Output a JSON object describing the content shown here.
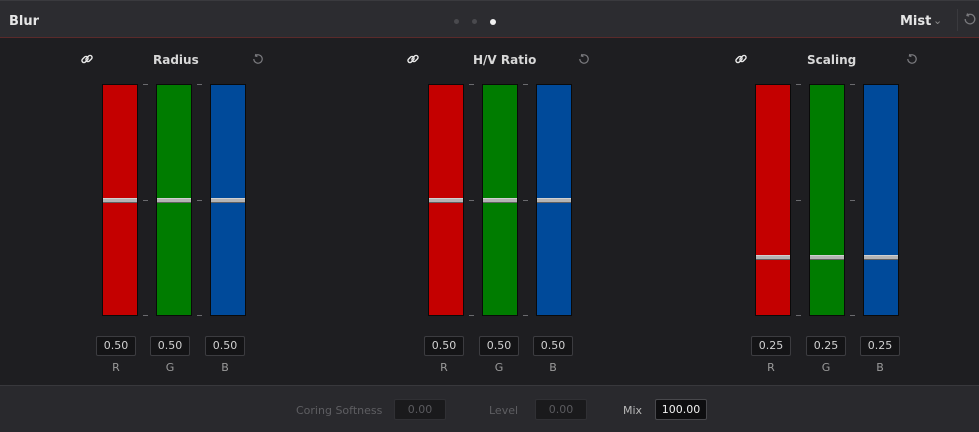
{
  "header": {
    "title": "Blur",
    "page_dots": 3,
    "active_dot": 3,
    "mode": "Mist"
  },
  "panels": [
    {
      "title": "Radius",
      "channels": [
        {
          "label": "R",
          "value": "0.50",
          "level": 0.5,
          "color": "#c40000"
        },
        {
          "label": "G",
          "value": "0.50",
          "level": 0.5,
          "color": "#007c00"
        },
        {
          "label": "B",
          "value": "0.50",
          "level": 0.5,
          "color": "#004a9a"
        }
      ]
    },
    {
      "title": "H/V Ratio",
      "channels": [
        {
          "label": "R",
          "value": "0.50",
          "level": 0.5,
          "color": "#c40000"
        },
        {
          "label": "G",
          "value": "0.50",
          "level": 0.5,
          "color": "#007c00"
        },
        {
          "label": "B",
          "value": "0.50",
          "level": 0.5,
          "color": "#004a9a"
        }
      ]
    },
    {
      "title": "Scaling",
      "channels": [
        {
          "label": "R",
          "value": "0.25",
          "level": 0.25,
          "color": "#c40000"
        },
        {
          "label": "G",
          "value": "0.25",
          "level": 0.25,
          "color": "#007c00"
        },
        {
          "label": "B",
          "value": "0.25",
          "level": 0.25,
          "color": "#004a9a"
        }
      ]
    }
  ],
  "footer": {
    "coring_softness_label": "Coring Softness",
    "coring_softness_value": "0.00",
    "level_label": "Level",
    "level_value": "0.00",
    "mix_label": "Mix",
    "mix_value": "100.00"
  }
}
